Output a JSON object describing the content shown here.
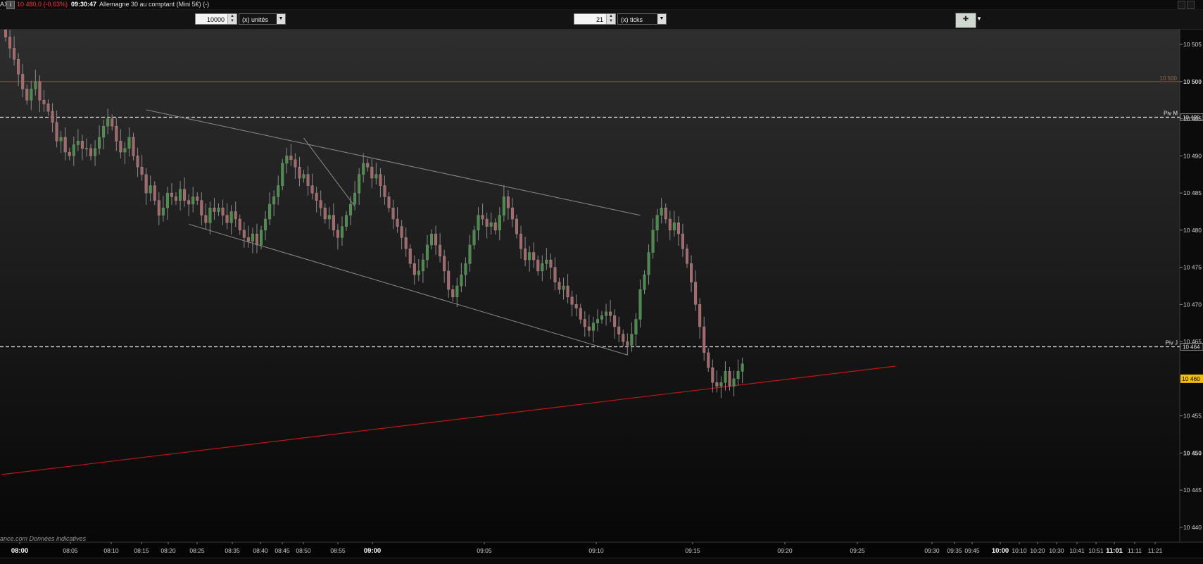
{
  "window": {
    "symbol": "AX",
    "info_icon": "i",
    "price_change": "10 480,0 (-0,63%)",
    "time": "09:30:47",
    "instrument": "Allemagne 30 au comptant (Mini 5€) (-)"
  },
  "toolbar": {
    "quantity_value": "10000",
    "quantity_unit": "(x) unités",
    "period_value": "21",
    "period_unit": "(x) ticks"
  },
  "credit": "ance.com Données indicatives",
  "colors": {
    "up": "#4d8a4d",
    "down": "#a06a6a",
    "wick": "#8a8a8a",
    "red_line": "#c41414",
    "resistance": "#8a5a2a",
    "current_price_bg": "#f0c000"
  },
  "price_axis": {
    "labels": [
      {
        "price": 10505,
        "text": "10 505",
        "bold": false
      },
      {
        "price": 10500,
        "text": "10 500",
        "bold": true
      },
      {
        "price": 10495,
        "text": "10 495",
        "bold": false
      },
      {
        "price": 10490,
        "text": "10 490",
        "bold": false
      },
      {
        "price": 10485,
        "text": "10 485",
        "bold": false
      },
      {
        "price": 10480,
        "text": "10 480",
        "bold": false
      },
      {
        "price": 10475,
        "text": "10 475",
        "bold": false
      },
      {
        "price": 10470,
        "text": "10 470",
        "bold": false
      },
      {
        "price": 10465,
        "text": "10 465",
        "bold": false
      },
      {
        "price": 10455,
        "text": "10 455",
        "bold": false
      },
      {
        "price": 10450,
        "text": "10 450",
        "bold": true
      },
      {
        "price": 10445,
        "text": "10 445",
        "bold": false
      },
      {
        "price": 10440,
        "text": "10 440",
        "bold": false
      }
    ],
    "current_price": {
      "price": 10460,
      "text": "10 460"
    },
    "resistance": {
      "price": 10500,
      "text": "10 500"
    },
    "pivots": [
      {
        "name": "Piv M",
        "price": 10495.2,
        "tag": "10 495"
      },
      {
        "name": "Piv J",
        "price": 10464.3,
        "tag": "10 464"
      }
    ]
  },
  "time_axis": {
    "labels": [
      {
        "text": "08:00",
        "bold": true
      },
      {
        "text": "08:05",
        "bold": false
      },
      {
        "text": "08:10",
        "bold": false
      },
      {
        "text": "08:15",
        "bold": false
      },
      {
        "text": "08:20",
        "bold": false
      },
      {
        "text": "08:25",
        "bold": false
      },
      {
        "text": "08:35",
        "bold": false
      },
      {
        "text": "08:40",
        "bold": false
      },
      {
        "text": "08:45",
        "bold": false
      },
      {
        "text": "08:50",
        "bold": false
      },
      {
        "text": "08:55",
        "bold": false
      },
      {
        "text": "09:00",
        "bold": true
      },
      {
        "text": "09:05",
        "bold": false
      },
      {
        "text": "09:10",
        "bold": false
      },
      {
        "text": "09:15",
        "bold": false
      },
      {
        "text": "09:20",
        "bold": false
      },
      {
        "text": "09:25",
        "bold": false
      },
      {
        "text": "09:30",
        "bold": false
      },
      {
        "text": "09:35",
        "bold": false
      },
      {
        "text": "09:45",
        "bold": false
      },
      {
        "text": "10:00",
        "bold": true
      },
      {
        "text": "10:10",
        "bold": false
      },
      {
        "text": "10:20",
        "bold": false
      },
      {
        "text": "10:30",
        "bold": false
      },
      {
        "text": "10:41",
        "bold": false
      },
      {
        "text": "10:51",
        "bold": false
      },
      {
        "text": "11:01",
        "bold": true
      },
      {
        "text": "11:11",
        "bold": false
      },
      {
        "text": "11:21",
        "bold": false
      }
    ]
  },
  "chart_data": {
    "type": "candlestick",
    "title": "",
    "ylim": [
      10438,
      10507
    ],
    "x_note": "bars indexed 0..(n-1), equal spacing; each bar = 21 ticks",
    "trendlines": [
      {
        "name": "channel-upper",
        "from": [
          33,
          10496.2
        ],
        "to": [
          149,
          10482.0
        ]
      },
      {
        "name": "channel-lower",
        "from": [
          43,
          10480.8
        ],
        "to": [
          146,
          10463.2
        ]
      },
      {
        "name": "diagonal",
        "from": [
          70,
          10492.4
        ],
        "to": [
          82,
          10483.2
        ]
      },
      {
        "name": "red-support",
        "from": [
          -1,
          10447.1
        ],
        "to": [
          209,
          10461.7
        ]
      }
    ],
    "open_from": 10510,
    "closes": [
      10506,
      10504.5,
      10503,
      10501,
      10499,
      10497.5,
      10499,
      10500,
      10497.5,
      10497,
      10496,
      10494.5,
      10492,
      10492.5,
      10490.5,
      10490,
      10491.5,
      10492,
      10491,
      10491,
      10490,
      10491,
      10492.5,
      10494,
      10495,
      10494,
      10492,
      10490.5,
      10491,
      10492.5,
      10490,
      10488.5,
      10487.5,
      10485,
      10486,
      10484,
      10482,
      10483,
      10485,
      10484.5,
      10484,
      10485.5,
      10484,
      10483.5,
      10484.5,
      10484,
      10482,
      10481,
      10483,
      10482.5,
      10483,
      10482,
      10481,
      10482.5,
      10481.5,
      10480,
      10479,
      10478.5,
      10479.5,
      10478,
      10480,
      10481.5,
      10483.5,
      10484.5,
      10486,
      10489,
      10490,
      10489.5,
      10488.5,
      10487,
      10487.5,
      10486,
      10485,
      10484,
      10483,
      10481.5,
      10482,
      10480,
      10479,
      10480.5,
      10482,
      10483.5,
      10485,
      10487.5,
      10489,
      10488.5,
      10487,
      10487.5,
      10486,
      10484.5,
      10483,
      10481.5,
      10480.5,
      10479,
      10477.5,
      10475.5,
      10474,
      10474.5,
      10476,
      10478,
      10479.5,
      10478,
      10476.5,
      10474.5,
      10472,
      10471,
      10472.5,
      10474,
      10475.5,
      10478,
      10480,
      10482,
      10481.5,
      10480.5,
      10481,
      10480,
      10482,
      10484.5,
      10483,
      10481.5,
      10479.5,
      10477.5,
      10476,
      10477,
      10476,
      10474.5,
      10475.5,
      10476,
      10475,
      10473,
      10472,
      10472.5,
      10471,
      10470,
      10469.5,
      10468,
      10467,
      10466.5,
      10467.5,
      10468,
      10468.5,
      10469,
      10468.5,
      10467,
      10466,
      10465,
      10464.5,
      10466,
      10468,
      10472,
      10474,
      10477,
      10480,
      10482,
      10483,
      10481.5,
      10480,
      10481,
      10479.5,
      10477.5,
      10475.5,
      10473,
      10470,
      10467,
      10463.5,
      10461.5,
      10459.5,
      10459,
      10459.5,
      10461,
      10459,
      10460,
      10461,
      10462
    ]
  }
}
